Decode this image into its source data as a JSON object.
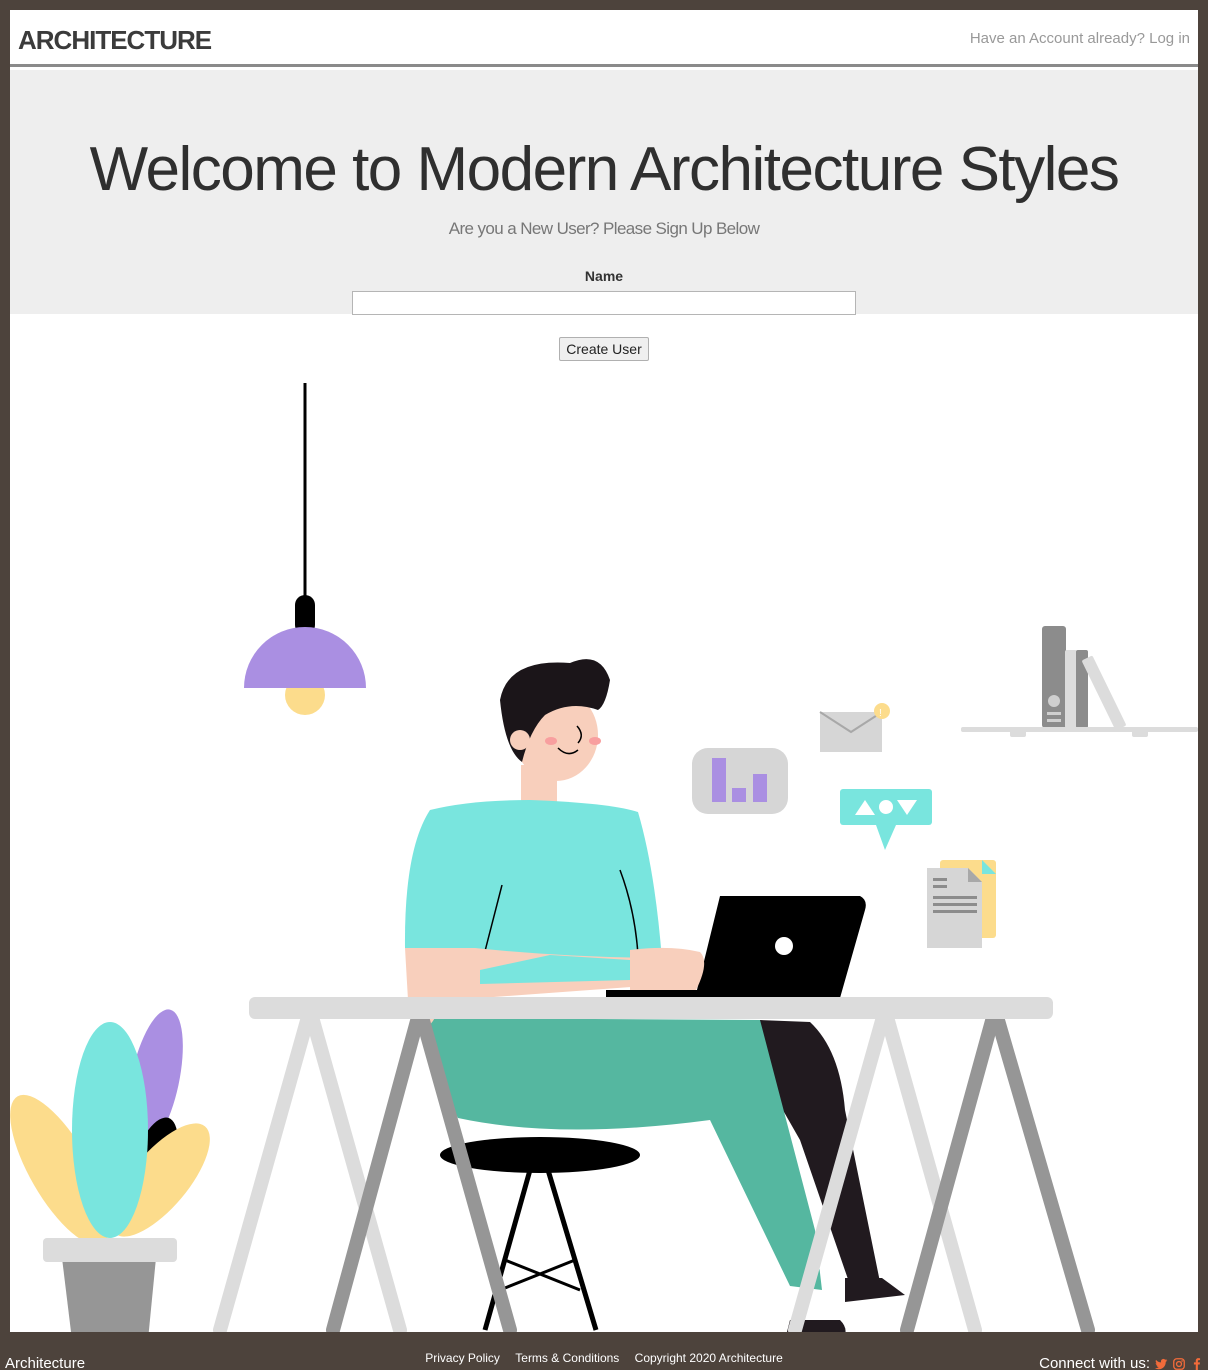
{
  "navbar": {
    "brand": "ARCHITECTURE",
    "login_link": "Have an Account already? Log in"
  },
  "hero": {
    "title": "Welcome to Modern Architecture Styles",
    "subtitle": "Are you a New User? Please Sign Up Below"
  },
  "form": {
    "name_label": "Name",
    "name_value": "",
    "submit_label": "Create User"
  },
  "footer": {
    "brand": "Architecture",
    "links": [
      "Privacy Policy",
      "Terms & Conditions",
      "Copyright 2020 Architecture"
    ],
    "connect_label": "Connect with us:",
    "social_icons": [
      "twitter-icon",
      "instagram-icon",
      "facebook-icon"
    ],
    "icon_color": "#f26b3a"
  },
  "colors": {
    "frame_bg": "#4d433c",
    "accent_teal": "#79e5de",
    "accent_purple": "#aa8fe2",
    "accent_yellow": "#fcdc8c"
  }
}
